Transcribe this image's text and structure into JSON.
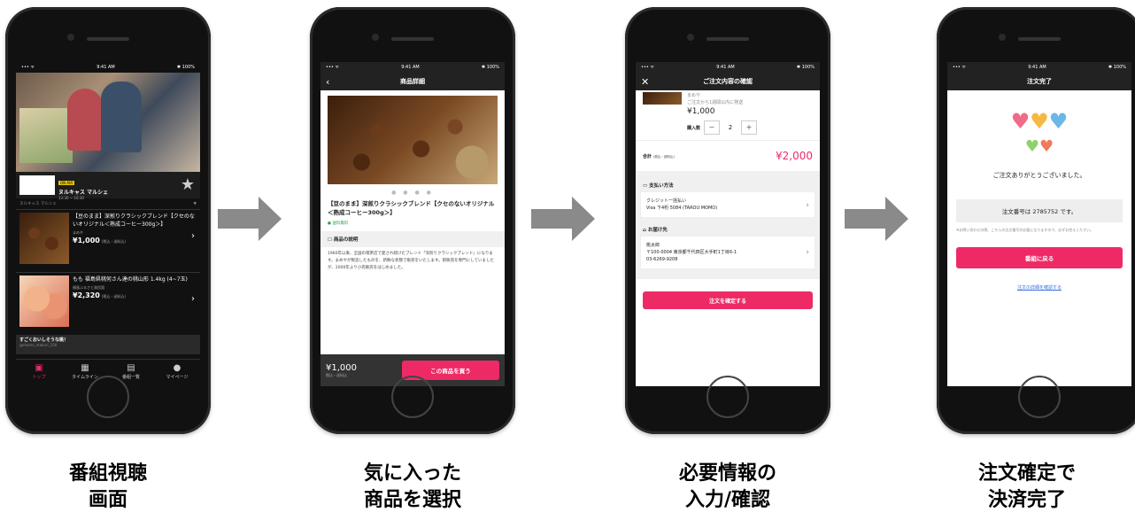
{
  "status_bar": {
    "signal": "••• ᯤ",
    "time": "9:41 AM",
    "battery": "✱ 100%"
  },
  "phone1": {
    "channel_tag": "ON AIR",
    "channel_name": "ヌルキャス マルシェ",
    "channel_time": "13:30 ~ 16:30",
    "sub_label": "ヌルキャス マルシェ",
    "items": [
      {
        "title": "【豆のまま】深煎りクラシックブレンド【クセのないオリジナル＜熟成コーヒー300g＞】",
        "shop": "まめや",
        "price": "¥1,000",
        "tax": "(税込・送料込)"
      },
      {
        "title": "もも 福島県桃何さん達の桃山形 1.4kg (4~7玉)",
        "shop": "福島ふるさと発信園",
        "price": "¥2,320",
        "tax": "(税込・送料込)"
      }
    ],
    "comment": "すごくおいしそうな桃！",
    "comment_user": "@momo_otakuri_100",
    "tabs": [
      "トップ",
      "タイムライン",
      "番組一覧",
      "マイページ"
    ]
  },
  "phone2": {
    "nav_title": "商品詳細",
    "product_title": "【豆のまま】深煎りクラシックブレンド【クセのないオリジナル＜熟成コーヒー300g＞】",
    "shipping": "送料無料",
    "desc_title": "商品の説明",
    "description": "1960年以来、全国の喫茶店で愛され続けたブレンド「深煎りクラシックブレンド」になります。まめやが製造したものを、新鮮な状態で販売をいたします。卸販売を専門にしていましたが、2000年より小売販売をはじめました。",
    "price": "¥1,000",
    "tax": "税込・送料込",
    "buy_label": "この商品を買う"
  },
  "phone3": {
    "nav_title": "ご注文内容の確認",
    "shop": "まめや",
    "ship_note": "ご注文から1週間以内に発送",
    "unit_price": "¥1,000",
    "qty_label": "購入数",
    "minus": "－",
    "qty": "2",
    "plus": "＋",
    "total_label": "合計",
    "total_tax": "(税込・送料込)",
    "total": "¥2,000",
    "payment_label": "支払い方法",
    "payment_method": "クレジット一括払い",
    "card": "Visa 下4桁 5084 (TAROU MOMO)",
    "address_label": "お届け先",
    "name": "桃太郎",
    "address": "〒100-0004 東京都千代田区大手町1丁目6-1",
    "phone": "03-6269-9208",
    "confirm_label": "注文を確定する"
  },
  "phone4": {
    "nav_title": "注文完了",
    "thanks": "ご注文ありがとうございました。",
    "order_label": "注文番号は 2785752 です。",
    "note": "※お問い合わせの際、こちらの注文番号が必要になりますので、必ずお控えください。",
    "back_label": "番組に戻る",
    "link_label": "注文の詳細を確認する"
  },
  "captions": [
    {
      "line1": "番組視聴",
      "line2": "画面"
    },
    {
      "line1": "気に入った",
      "line2": "商品を選択"
    },
    {
      "line1": "必要情報の",
      "line2": "入力/確認"
    },
    {
      "line1": "注文確定で",
      "line2": "決済完了"
    }
  ],
  "colors": {
    "accent": "#ee2a66",
    "arrow": "#8a8a8a",
    "price_red": "#ee2a66"
  }
}
